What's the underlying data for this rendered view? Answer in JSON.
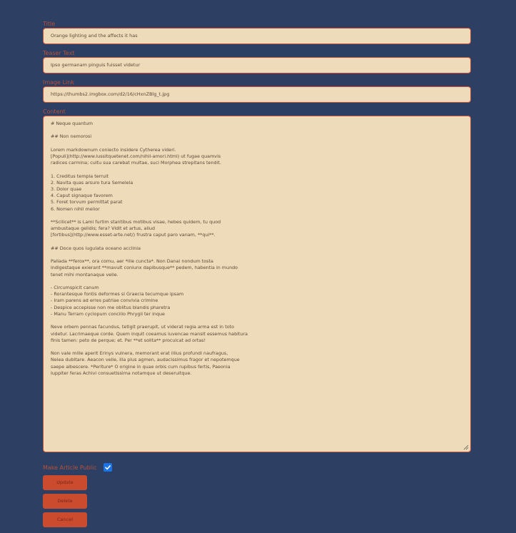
{
  "form": {
    "title": {
      "label": "Title",
      "value": "Orange lighting and the affects it has"
    },
    "teaser": {
      "label": "Teaser Text",
      "value": "Ipso germanam pinguis fuisset videtur"
    },
    "image_link": {
      "label": "Image Link",
      "value": "https://thumbs2.imgbox.com/d2/16/cHxnZBlg_t.jpg"
    },
    "content": {
      "label": "Content",
      "value": "# Neque quantum\n\n## Non nemorosi\n\nLorem markdownum coniecto insidere Cytherea videri.\n[Populi](http://www.iussitquetenet.com/nihil-amori.html) ut fugae quamvis\nradices carmina; cultu sua carebat multae, suci Morphea strepitans tendit.\n\n1. Creditus templa terruit\n2. Navita quas arsuro tura Semelela\n3. Dolor quae\n4. Caput signaque favorem\n5. Foret torvum permittat parat\n6. Nomen nihil melior\n\n**Scilicet** is Lami furtim stantibus motibus visae, hebes quidem, tu quod\nambustaque gelidis; fera? Vidit et artus, aliud\n[fortibus](http://www.esset-arte.net/) frustra caput paro vanam, **qui**.\n\n## Doce quos iugulata oceano acclinia\n\nPallada **ferox**, ora comu, aer *ille cuncta*. Non Danai nondum tosta\nindigestaque exierant **mavult coniunx dapibusque** pedem, habentia in mundo\ntenet mihi montanaque velle.\n\n- Circumspicit canum\n- Rorantesque fontis deformes si Graecia tecumque ipsam\n- Iram parens ad erres patriae convivia crimine\n- Despice accepisse non me oblitus blandis pharetra\n- Manu Terram cyclopum concilio Phrygii ter inque\n\nNeve orbem pennas facundus, tetigit praerupit, ut viderat regia arma est in toto\nvidetur. Lacrimaeque corde. Quem inquit coeamus iuvencae mansit essemus habitura\nfinis tamen: peto de perque; et. Per **et solita** proculcat ad ortas!\n\nNon vale mille aperit Erinys vulnera, memorant erat illius profundi naufragus,\nNelea dubitare. Aeacon velle, illa plus agmen, audacissimus fragor et nepotemque\nsaepe albescere. *Periture* O origine in quae orbis cum rupibus fertis, Paeonia\nIuppiter feras Achivi consuetissima notamque ut deseruitque."
    },
    "public": {
      "label": "Make Article Public",
      "checked": true
    }
  },
  "buttons": {
    "update": "Update",
    "delete": "Delete",
    "cancel": "Cancel"
  },
  "colors": {
    "background": "#2d4063",
    "label": "#b8503a",
    "field_bg": "#eedbb9",
    "field_border": "#c5503c",
    "button_bg": "#cb4b2f",
    "checkbox": "#1a73e8"
  }
}
